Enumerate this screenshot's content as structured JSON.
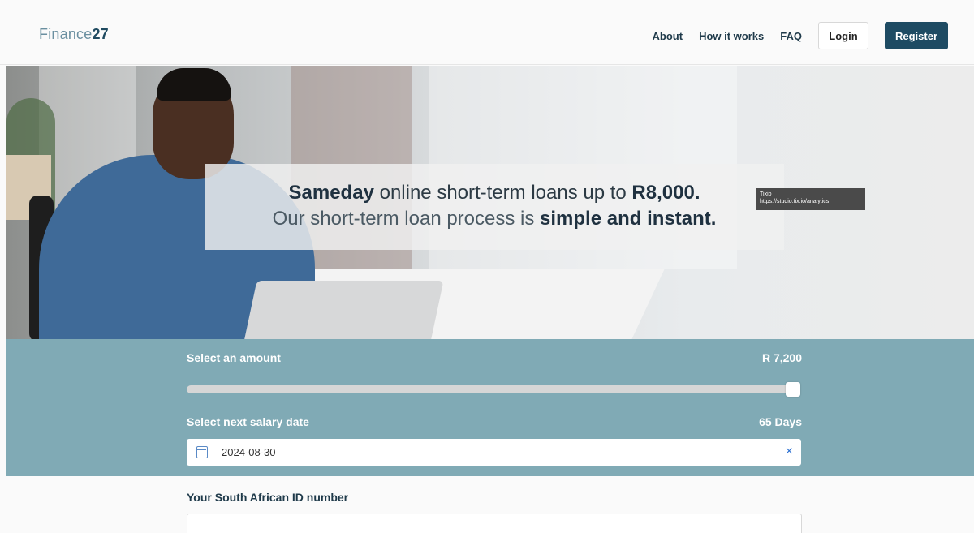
{
  "header": {
    "logo_text": "Finance",
    "logo_num": "27",
    "nav": [
      "About",
      "How it works",
      "FAQ"
    ],
    "login_label": "Login",
    "register_label": "Register"
  },
  "hero": {
    "line1_bold": "Sameday",
    "line1_rest": " online short-term loans up to ",
    "line1_amount": "R8,000.",
    "line2_rest": "Our short-term loan process is ",
    "line2_bold": "simple and instant.",
    "tooltip_title": "Tixio",
    "tooltip_url": "https://studio.tix.io/analytics"
  },
  "loan": {
    "amount_label": "Select an amount",
    "amount_value": "R 7,200",
    "amount_fraction": 0.9,
    "salary_label": "Select next salary date",
    "salary_value": "65 Days",
    "date_value": "2024-08-30",
    "clear_symbol": "×"
  },
  "id_section": {
    "label": "Your South African ID number",
    "value": ""
  },
  "colors": {
    "primary": "#1e4b63",
    "panel": "#80aab5"
  }
}
